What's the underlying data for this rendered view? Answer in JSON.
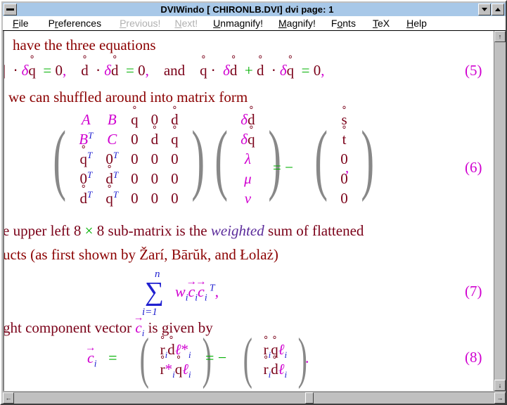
{
  "window": {
    "title": "DVIWindo  [ CHIRONLB.DVI]   dvi page:  1",
    "sysmenu_icon": "minimize-bar-icon",
    "btn_down_icon": "triangle-down-icon",
    "btn_up_icon": "triangle-up-icon"
  },
  "menu": {
    "items": [
      {
        "label": "File",
        "accel": "F",
        "disabled": false
      },
      {
        "label": "Preferences",
        "accel": "r",
        "disabled": false
      },
      {
        "label": "Previous!",
        "accel": "P",
        "disabled": true
      },
      {
        "label": "Next!",
        "accel": "N",
        "disabled": true
      },
      {
        "label": "Unmagnify!",
        "accel": "U",
        "disabled": false
      },
      {
        "label": "Magnify!",
        "accel": "M",
        "disabled": false
      },
      {
        "label": "Fonts",
        "accel": "o",
        "disabled": false
      },
      {
        "label": "TeX",
        "accel": "T",
        "disabled": false
      },
      {
        "label": "Help",
        "accel": "H",
        "disabled": false
      }
    ]
  },
  "scrollbars": {
    "vertical": {
      "up_arrow": "↑",
      "down_arrow": "↓"
    },
    "horizontal": {
      "left_arrow": "←",
      "right_arrow": "→",
      "thumb_position_pct": 60
    }
  },
  "document": {
    "line1": "have the three equations",
    "eq5": {
      "fragment": "⋅ δq̊ = 0,    d̊ ⋅ δd̊ = 0,   and   q̊ ⋅ δd̊ + d̊ ⋅ δq̊ = 0,",
      "number": "(5)",
      "terms": {
        "t1_dot": "⋅",
        "t1_delta": "δ",
        "t1_q": "q",
        "eq": "=",
        "zero": "0",
        "comma": ",",
        "d": "d",
        "and": "and",
        "plus": "+"
      }
    },
    "line2": "we can shuffled around into matrix form",
    "eq6": {
      "number": "(6)",
      "matrixA": [
        [
          "A",
          "B",
          "q̊",
          "0",
          "d̊"
        ],
        [
          "B^T",
          "C",
          "0",
          "d̊",
          "q̊"
        ],
        [
          "q̊^T",
          "0^T",
          "0",
          "0",
          "0"
        ],
        [
          "0^T",
          "d̊^T",
          "0",
          "0",
          "0"
        ],
        [
          "d̊^T",
          "q̊^T",
          "0",
          "0",
          "0"
        ]
      ],
      "vectorX": [
        "δd̊",
        "δq̊",
        "λ",
        "μ",
        "ν"
      ],
      "relation": "= −",
      "vectorB": [
        "s̊",
        "t̊",
        "0",
        "0",
        "0"
      ],
      "trailing_comma": ","
    },
    "line3_pre": "e upper left 8 ",
    "line3_times": "×",
    "line3_mid": " 8 sub-matrix is the ",
    "line3_em": "weighted",
    "line3_post": " sum of flattened",
    "line4": "ucts (as first shown by Žarí, Bārŭk, and Łolaż)",
    "eq7": {
      "upper_limit": "n",
      "sigma": "∑",
      "lower_limit": "i=1",
      "weight": "w",
      "weight_sub": "i",
      "vec_c": "c",
      "vec_sub": "i",
      "transpose": "T",
      "trailing_comma": ",",
      "number": "(7)"
    },
    "line5_pre": "ght component vector ",
    "line5_c": "c",
    "line5_sub": "i",
    "line5_post": " is given by",
    "eq8": {
      "lhs_c": "c",
      "lhs_sub": "i",
      "equals": "=",
      "mat1_row1": "r̊ᵢd̊ℓ*ᵢ",
      "mat1_row2": "r̊*ᵢq̊ℓᵢ",
      "relation": "= −",
      "mat2_row1": "r̊ᵢq̊ℓᵢ",
      "mat2_row2": "r̊ᵢd̊ℓᵢ",
      "trailing_period": ".",
      "number": "(8)"
    }
  },
  "colors": {
    "titlebar_bg": "#a8c8e8",
    "face": "#c0c0c0",
    "text_body": "#8b0000",
    "magenta": "#d000d0",
    "green": "#00b000",
    "blue": "#2020d0",
    "purple": "#5a2a9a"
  }
}
